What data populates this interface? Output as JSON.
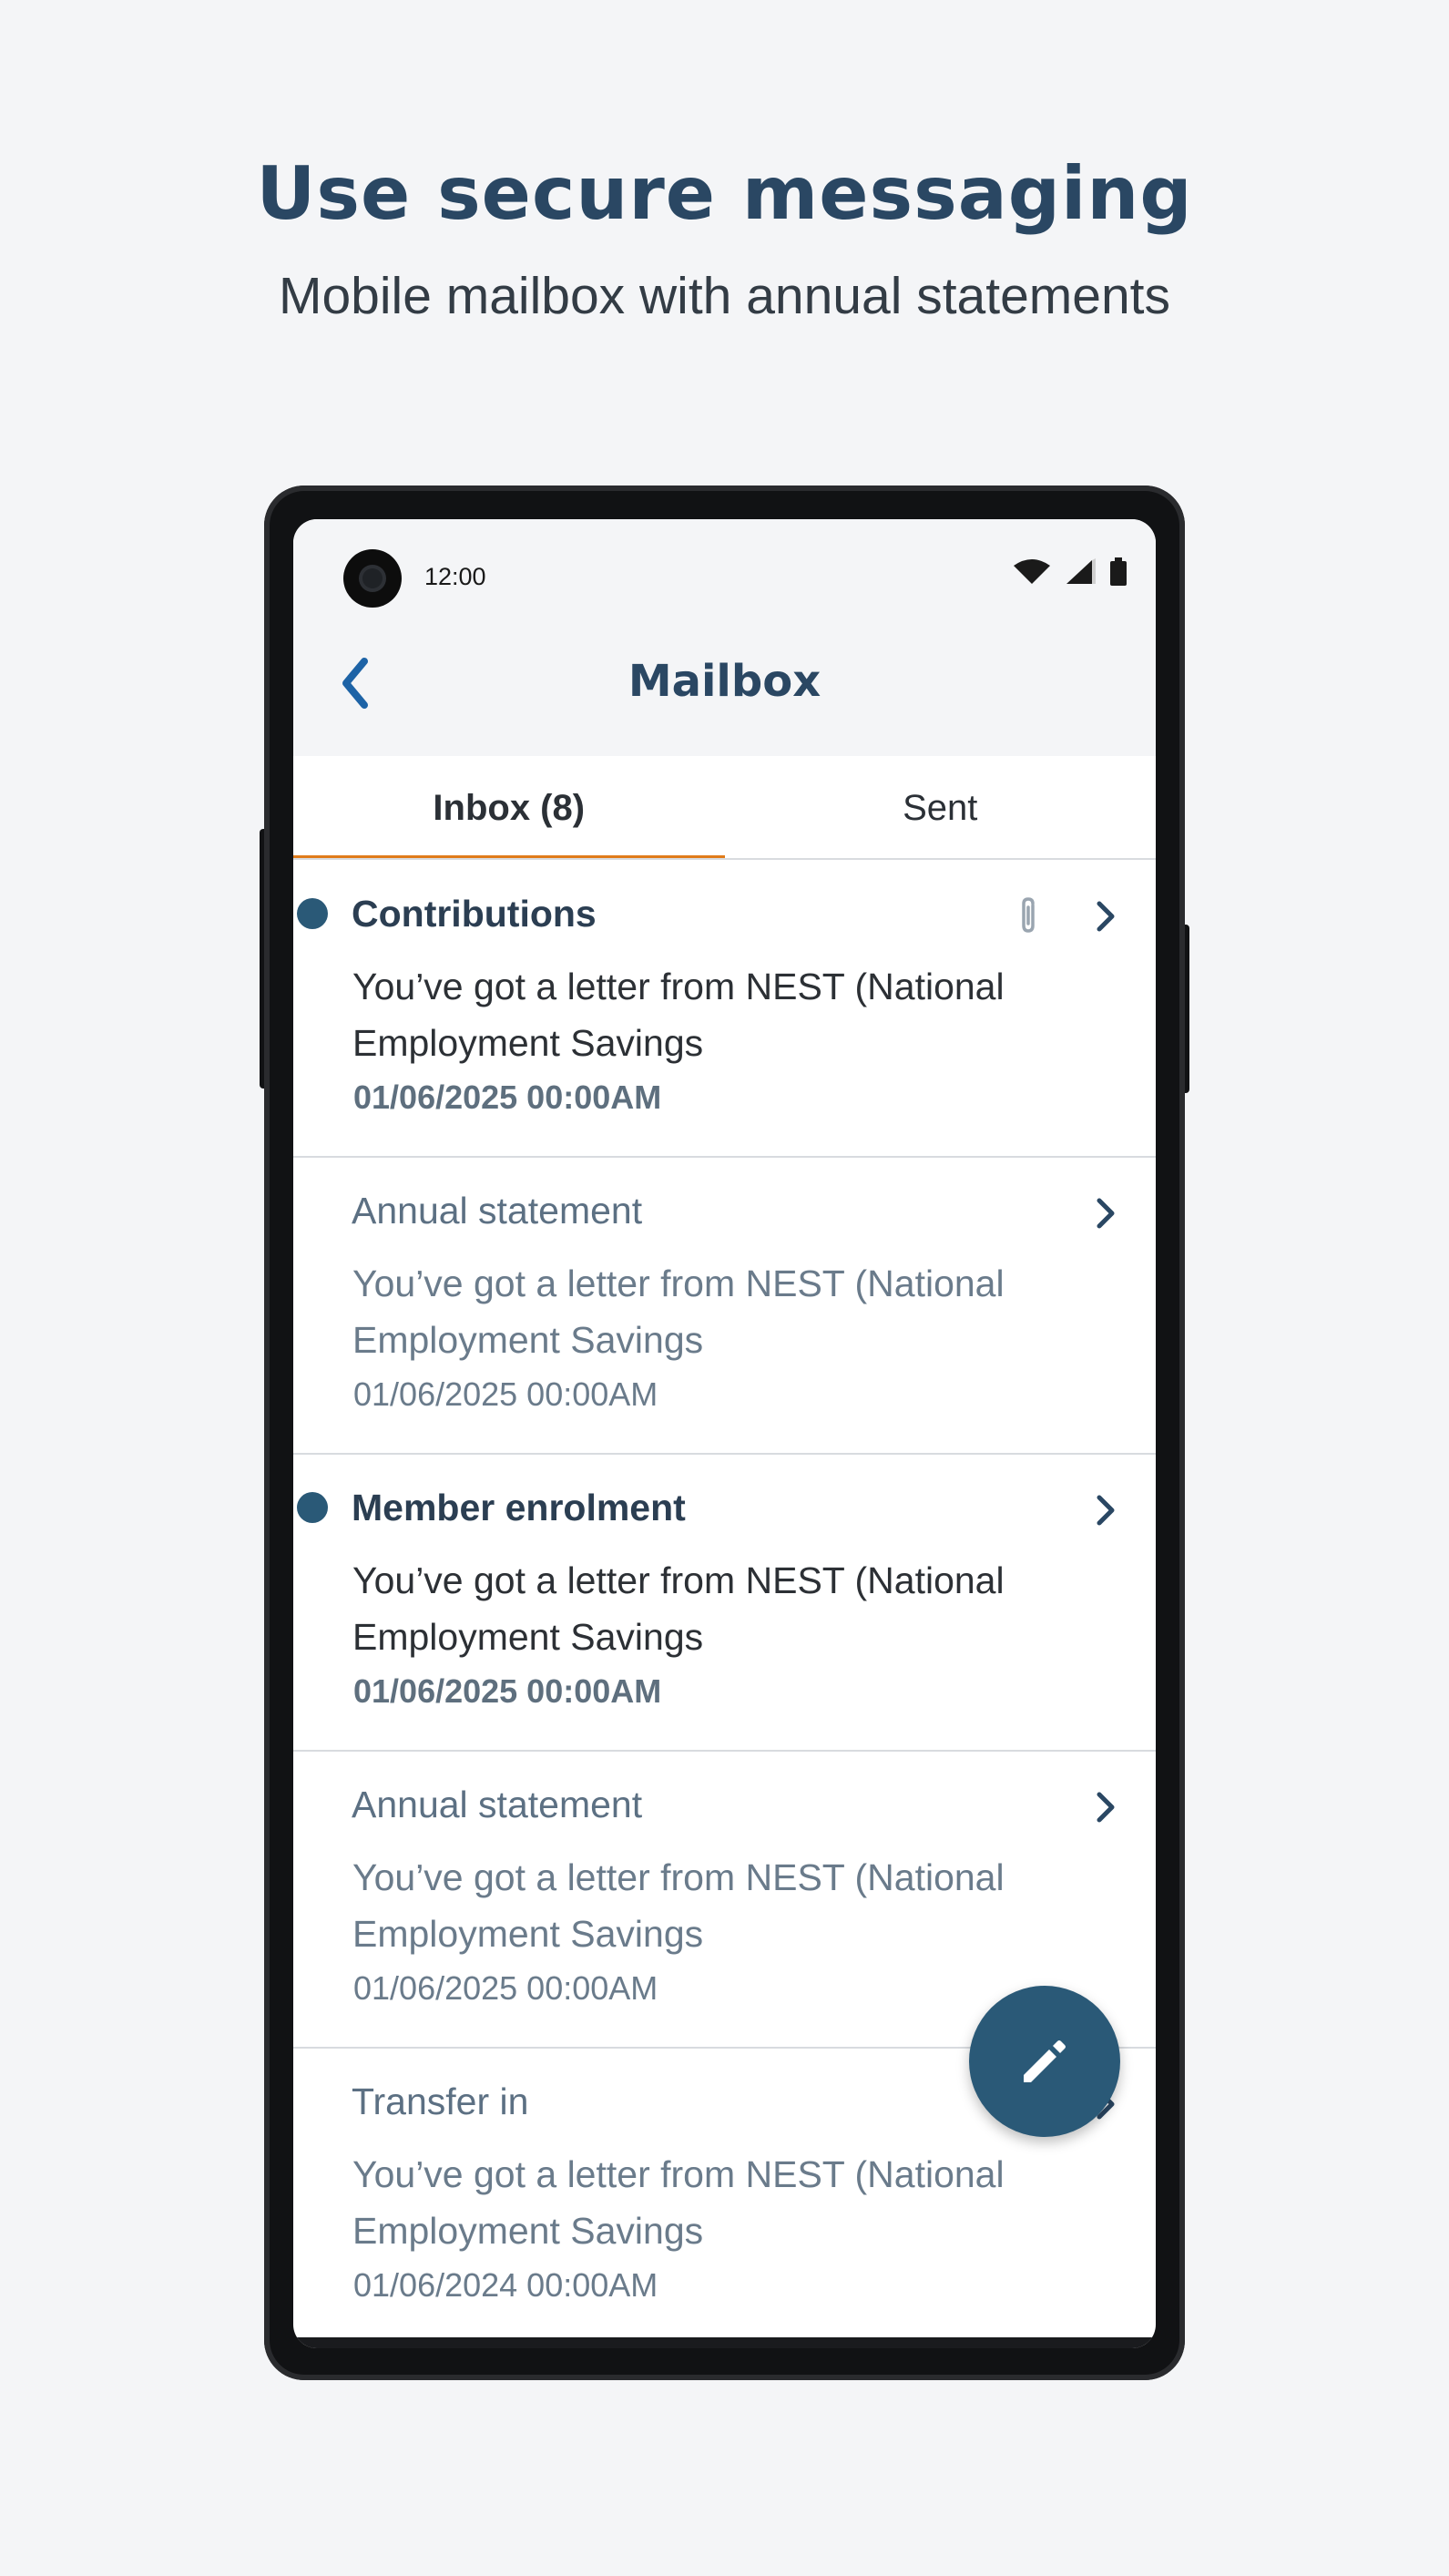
{
  "promo": {
    "headline": "Use secure messaging",
    "subheadline": "Mobile mailbox with annual statements"
  },
  "status_bar": {
    "time": "12:00",
    "icons": [
      "wifi-icon",
      "signal-icon",
      "battery-icon"
    ]
  },
  "app_bar": {
    "back_icon": "chevron-left-icon",
    "title": "Mailbox"
  },
  "tabs": [
    {
      "label": "Inbox (8)",
      "active": true
    },
    {
      "label": "Sent",
      "active": false
    }
  ],
  "messages": [
    {
      "subject": "Contributions",
      "preview": "You’ve got a letter from NEST (National Employment Savings",
      "date": "01/06/2025 00:00AM",
      "unread": true,
      "has_attachment": true
    },
    {
      "subject": "Annual statement",
      "preview": "You’ve got a letter from NEST (National Employment Savings",
      "date": "01/06/2025 00:00AM",
      "unread": false,
      "has_attachment": false
    },
    {
      "subject": "Member enrolment",
      "preview": "You’ve got a letter from NEST (National Employment Savings",
      "date": "01/06/2025 00:00AM",
      "unread": true,
      "has_attachment": false
    },
    {
      "subject": "Annual statement",
      "preview": "You’ve got a letter from NEST (National Employment Savings",
      "date": "01/06/2025 00:00AM",
      "unread": false,
      "has_attachment": false
    },
    {
      "subject": "Transfer in",
      "preview": "You’ve got a letter from NEST (National Employment Savings",
      "date": "01/06/2024 00:00AM",
      "unread": false,
      "has_attachment": false
    }
  ],
  "fab": {
    "icon": "pencil-icon"
  },
  "colors": {
    "brand_navy": "#2a4763",
    "accent_orange": "#e07b1a",
    "fab_blue": "#2a5977",
    "unread_dot": "#2a5977"
  }
}
